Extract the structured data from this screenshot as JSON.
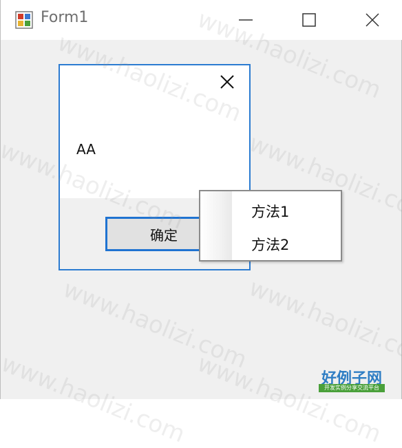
{
  "window": {
    "title": "Form1",
    "icon": "winforms-app-icon",
    "controls": [
      "minimize-icon",
      "maximize-icon",
      "close-icon"
    ]
  },
  "dialog": {
    "message": "AA",
    "ok_label": "确定",
    "close_icon": "close-icon",
    "accent": "#2b7bd1"
  },
  "context_menu": {
    "items": [
      {
        "label": "方法1"
      },
      {
        "label": "方法2"
      }
    ]
  },
  "watermark": {
    "text": "www.haolizi.com",
    "brand_main": "好例子网",
    "brand_sub": "开发实例分享交流平台"
  }
}
